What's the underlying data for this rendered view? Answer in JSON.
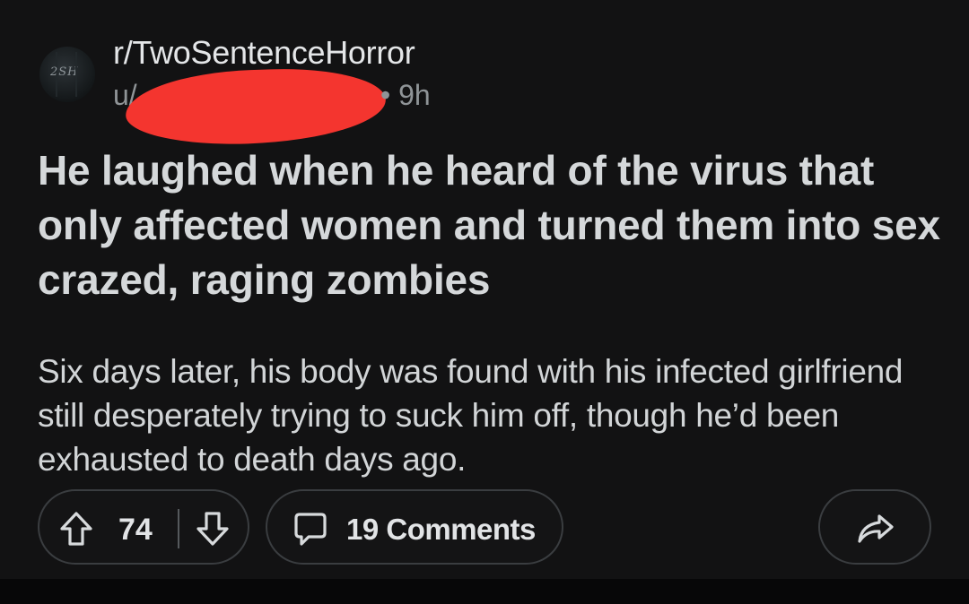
{
  "post": {
    "avatar_text": "2SH",
    "subreddit": "r/TwoSentenceHorror",
    "username_prefix": "u/",
    "separator": "•",
    "age": "9h",
    "title": "He laughed when he heard of the virus that only affected women and turned them into sex crazed, raging zombies",
    "body": "Six days later, his body was found with his infected girlfriend still desperately trying to suck him off, though he’d been exhausted to death days ago."
  },
  "actions": {
    "upvote_icon": "arrow-up-icon",
    "vote_count": "74",
    "downvote_icon": "arrow-down-icon",
    "comment_icon": "speech-bubble-icon",
    "comments_label": "19 Comments",
    "share_icon": "share-arrow-icon"
  },
  "colors": {
    "background": "#121213",
    "text": "#d7dadc",
    "muted": "#8f9497",
    "redaction": "#f4352f"
  }
}
